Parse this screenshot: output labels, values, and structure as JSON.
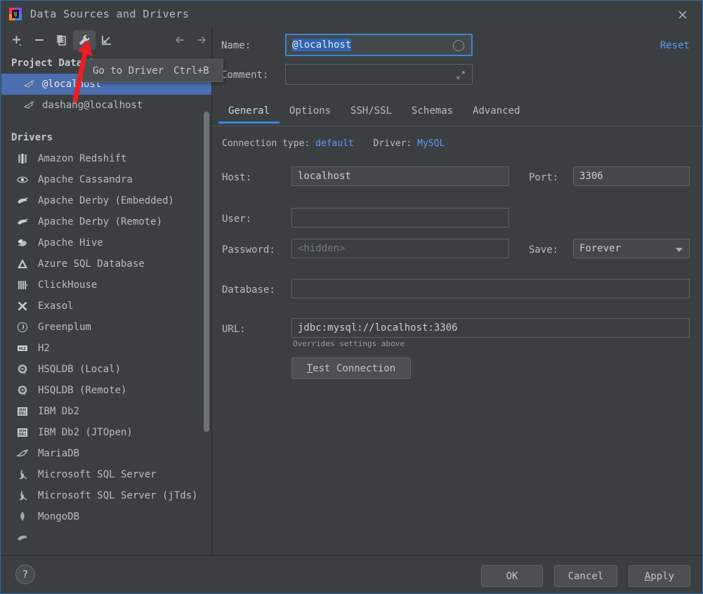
{
  "window": {
    "title": "Data Sources and Drivers",
    "logo_letters": "IJ",
    "close_icon": "close-icon"
  },
  "toolbar": {
    "buttons": [
      {
        "name": "add-button",
        "icon": "plus-icon",
        "active": false
      },
      {
        "name": "remove-button",
        "icon": "minus-icon",
        "active": false
      },
      {
        "name": "duplicate-button",
        "icon": "copy-icon",
        "active": false
      },
      {
        "name": "go-to-driver-button",
        "icon": "wrench-icon",
        "active": true
      },
      {
        "name": "import-button",
        "icon": "import-arrow-icon",
        "active": false
      }
    ],
    "nav": [
      {
        "name": "back-button",
        "icon": "arrow-left-icon"
      },
      {
        "name": "forward-button",
        "icon": "arrow-right-icon"
      }
    ]
  },
  "tooltip": {
    "label": "Go to Driver",
    "shortcut": "Ctrl+B"
  },
  "tree": {
    "project_header": "Project Data Sources",
    "data_sources": [
      {
        "label": "@localhost",
        "icon": "mysql-dolphin-icon",
        "selected": true
      },
      {
        "label": "dashang@localhost",
        "icon": "mysql-dolphin-icon",
        "selected": false
      }
    ],
    "drivers_header": "Drivers",
    "drivers": [
      {
        "label": "Amazon Redshift",
        "icon": "redshift-icon"
      },
      {
        "label": "Apache Cassandra",
        "icon": "cassandra-eye-icon"
      },
      {
        "label": "Apache Derby (Embedded)",
        "icon": "derby-icon"
      },
      {
        "label": "Apache Derby (Remote)",
        "icon": "derby-icon"
      },
      {
        "label": "Apache Hive",
        "icon": "hive-bee-icon"
      },
      {
        "label": "Azure SQL Database",
        "icon": "azure-icon"
      },
      {
        "label": "ClickHouse",
        "icon": "clickhouse-icon"
      },
      {
        "label": "Exasol",
        "icon": "exasol-x-icon"
      },
      {
        "label": "Greenplum",
        "icon": "greenplum-icon"
      },
      {
        "label": "H2",
        "icon": "h2-icon"
      },
      {
        "label": "HSQLDB (Local)",
        "icon": "hsqldb-icon"
      },
      {
        "label": "HSQLDB (Remote)",
        "icon": "hsqldb-icon"
      },
      {
        "label": "IBM Db2",
        "icon": "ibm-db2-icon"
      },
      {
        "label": "IBM Db2 (JTOpen)",
        "icon": "ibm-db2-icon"
      },
      {
        "label": "MariaDB",
        "icon": "mariadb-seal-icon"
      },
      {
        "label": "Microsoft SQL Server",
        "icon": "mssql-icon"
      },
      {
        "label": "Microsoft SQL Server (jTds)",
        "icon": "mssql-icon"
      },
      {
        "label": "MongoDB",
        "icon": "mongodb-leaf-icon"
      }
    ]
  },
  "form": {
    "name_label": "Name:",
    "name_value": "@localhost",
    "reset_label": "Reset",
    "comment_label": "Comment:",
    "comment_value": "",
    "tabs": [
      {
        "label": "General",
        "active": true
      },
      {
        "label": "Options",
        "active": false
      },
      {
        "label": "SSH/SSL",
        "active": false
      },
      {
        "label": "Schemas",
        "active": false
      },
      {
        "label": "Advanced",
        "active": false
      }
    ],
    "connection_type_label": "Connection type:",
    "connection_type_value": "default",
    "driver_label": "Driver:",
    "driver_value": "MySQL",
    "host_label": "Host:",
    "host_value": "localhost",
    "port_label": "Port:",
    "port_value": "3306",
    "user_label": "User:",
    "user_value": "",
    "password_label": "Password:",
    "password_placeholder": "<hidden>",
    "save_label": "Save:",
    "save_value": "Forever",
    "database_label": "Database:",
    "database_value": "",
    "url_label": "URL:",
    "url_value": "jdbc:mysql://localhost:3306",
    "url_hint": "Overrides settings above",
    "test_connection_prefix": "T",
    "test_connection_rest": "est Connection"
  },
  "footer": {
    "help_label": "?",
    "ok_label": "OK",
    "cancel_label": "Cancel",
    "apply_prefix": "A",
    "apply_rest": "pply"
  },
  "colors": {
    "background": "#3c3f41",
    "selection_blue": "#4b6eaf",
    "accent_blue": "#3d86d4",
    "link_blue": "#589df6",
    "text": "#bbbbbb",
    "annotation_red": "#ee1c25"
  }
}
